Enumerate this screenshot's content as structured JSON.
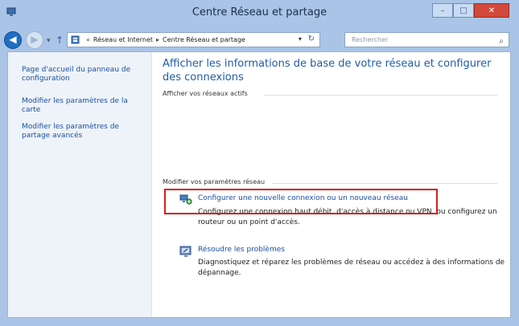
{
  "window": {
    "title": "Centre Réseau et partage",
    "buttons": {
      "minimize": "–",
      "maximize": "□",
      "close": "✕"
    }
  },
  "navbar": {
    "breadcrumbs": [
      "Réseau et Internet",
      "Centre Réseau et partage"
    ],
    "search_placeholder": "Rechercher"
  },
  "sidebar": {
    "items": [
      {
        "label": "Page d'accueil du panneau de configuration"
      },
      {
        "label": "Modifier les paramètres de la carte"
      },
      {
        "label": "Modifier les paramètres de partage avancés"
      }
    ]
  },
  "main": {
    "heading": "Afficher les informations de base de votre réseau et configurer des connexions",
    "active_networks_label": "Afficher vos réseaux actifs",
    "change_settings_label": "Modifier vos paramètres réseau",
    "tasks": [
      {
        "link": "Configurer une nouvelle connexion ou un nouveau réseau",
        "desc": "Configurez une connexion haut débit, d'accès à distance ou VPN, ou configurez un routeur ou un point d'accès.",
        "icon": "network-connection-icon"
      },
      {
        "link": "Résoudre les problèmes",
        "desc": "Diagnostiquez et réparez les problèmes de réseau ou accédez à des informations de dépannage.",
        "icon": "troubleshoot-icon"
      }
    ]
  },
  "colors": {
    "frame": "#a9c4e6",
    "link": "#1b4fa0",
    "highlight": "#d42020",
    "close_button": "#d24a3c"
  }
}
